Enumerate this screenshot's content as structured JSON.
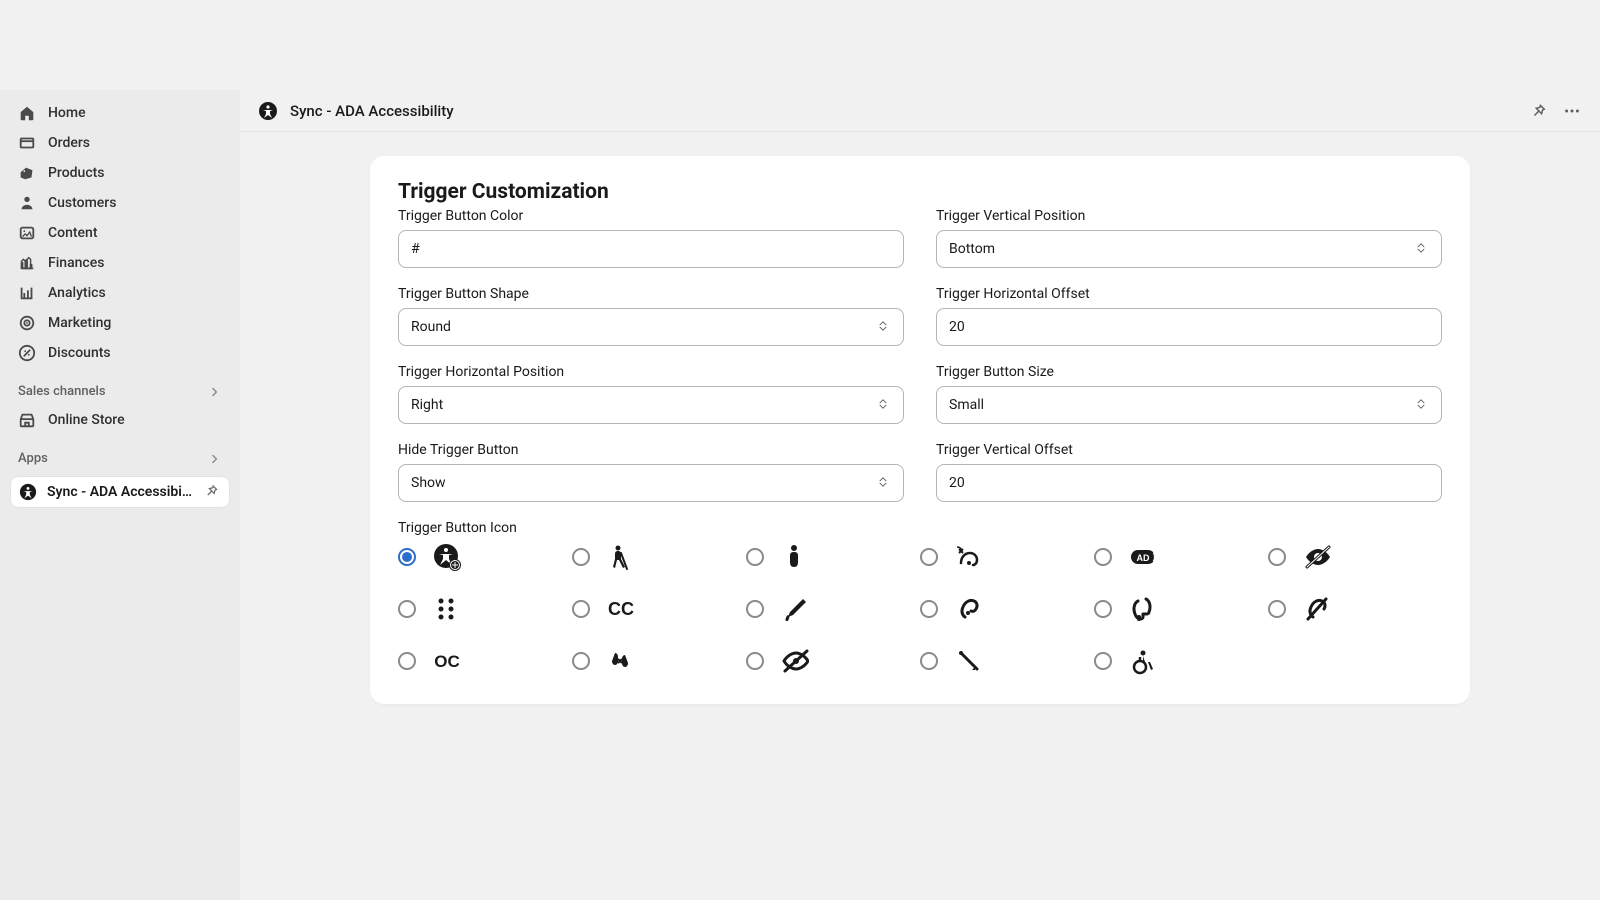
{
  "sidebar": {
    "items": [
      {
        "label": "Home",
        "icon": "home-icon"
      },
      {
        "label": "Orders",
        "icon": "orders-icon"
      },
      {
        "label": "Products",
        "icon": "products-icon"
      },
      {
        "label": "Customers",
        "icon": "customers-icon"
      },
      {
        "label": "Content",
        "icon": "content-icon"
      },
      {
        "label": "Finances",
        "icon": "finances-icon"
      },
      {
        "label": "Analytics",
        "icon": "analytics-icon"
      },
      {
        "label": "Marketing",
        "icon": "marketing-icon"
      },
      {
        "label": "Discounts",
        "icon": "discounts-icon"
      }
    ],
    "sales_channels_header": "Sales channels",
    "sales_channels": [
      {
        "label": "Online Store",
        "icon": "store-icon"
      }
    ],
    "apps_header": "Apps",
    "pinned_app": {
      "label": "Sync - ADA Accessibi...",
      "icon": "accessibility-app-icon"
    }
  },
  "topbar": {
    "title": "Sync - ADA Accessibility"
  },
  "card": {
    "title": "Trigger Customization",
    "fields": {
      "trigger_button_color": {
        "label": "Trigger Button Color",
        "value": "#"
      },
      "trigger_vertical_position": {
        "label": "Trigger Vertical Position",
        "value": "Bottom"
      },
      "trigger_button_shape": {
        "label": "Trigger Button Shape",
        "value": "Round"
      },
      "trigger_horizontal_offset": {
        "label": "Trigger Horizontal Offset",
        "value": "20"
      },
      "trigger_horizontal_position": {
        "label": "Trigger Horizontal Position",
        "value": "Right"
      },
      "trigger_button_size": {
        "label": "Trigger Button Size",
        "value": "Small"
      },
      "hide_trigger_button": {
        "label": "Hide Trigger Button",
        "value": "Show"
      },
      "trigger_vertical_offset": {
        "label": "Trigger Vertical Offset",
        "value": "20"
      },
      "trigger_button_icon": {
        "label": "Trigger Button Icon",
        "selected_index": 0
      }
    },
    "icon_options": [
      "accessibility-person-gear-icon",
      "blind-cane-icon",
      "person-icon",
      "assistive-listening-icon",
      "audio-description-icon",
      "eye-slash-icon",
      "braille-icon",
      "closed-captions-icon",
      "crutch-icon",
      "ear-icon",
      "headset-icon",
      "ear-slash-icon",
      "open-captions-icon",
      "sign-language-icon",
      "low-vision-icon",
      "probing-cane-icon",
      "wheelchair-icon"
    ]
  }
}
